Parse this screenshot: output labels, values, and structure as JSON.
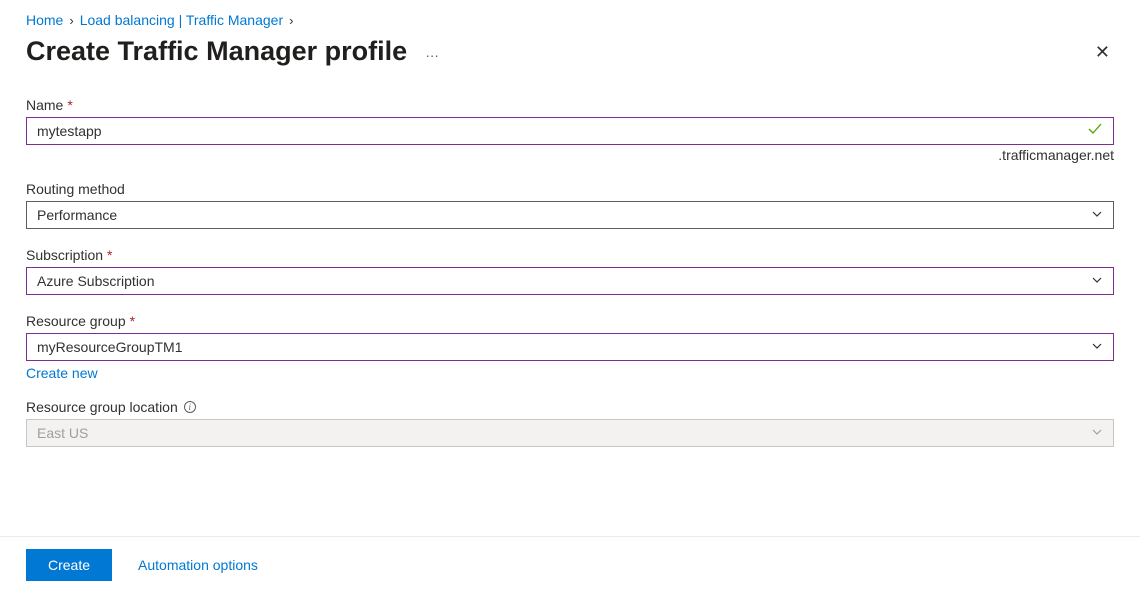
{
  "breadcrumb": {
    "home": "Home",
    "load_balancing": "Load balancing | Traffic Manager"
  },
  "title": "Create Traffic Manager profile",
  "fields": {
    "name": {
      "label": "Name",
      "value": "mytestapp",
      "suffix": ".trafficmanager.net"
    },
    "routing_method": {
      "label": "Routing method",
      "value": "Performance"
    },
    "subscription": {
      "label": "Subscription",
      "value": "Azure Subscription"
    },
    "resource_group": {
      "label": "Resource group",
      "value": "myResourceGroupTM1",
      "create_new": "Create new"
    },
    "rg_location": {
      "label": "Resource group location",
      "value": "East US"
    }
  },
  "footer": {
    "create": "Create",
    "automation": "Automation options"
  }
}
